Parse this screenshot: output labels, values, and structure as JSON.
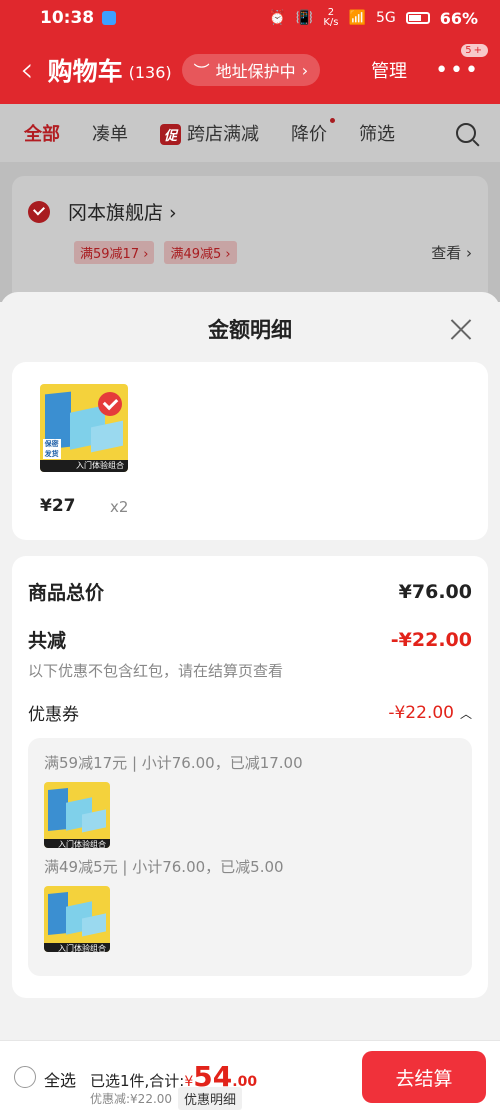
{
  "status_bar": {
    "time": "10:38",
    "net_speed": "2\nK/s",
    "signal": "5G",
    "battery": "66%"
  },
  "header": {
    "title": "购物车",
    "count": "(136)",
    "address_protect": "地址保护中",
    "manage": "管理",
    "more_badge": "5+"
  },
  "tabs": [
    {
      "label": "全部"
    },
    {
      "label": "凑单"
    },
    {
      "label": "跨店满减",
      "badge": "促"
    },
    {
      "label": "降价"
    },
    {
      "label": "筛选"
    }
  ],
  "store": {
    "name": "冈本旗舰店",
    "promos": [
      "满59减17",
      "满49减5"
    ],
    "view": "查看"
  },
  "sheet": {
    "title": "金额明细",
    "product": {
      "price": "¥27",
      "qty": "x2",
      "thumb_band": "入门体验组合",
      "thumb_tag_left": "保密\n发货",
      "thumb_top": "SKIN润滑20片"
    },
    "total_label": "商品总价",
    "total_value": "¥76.00",
    "discount_label": "共减",
    "discount_value": "-¥22.00",
    "note": "以下优惠不包含红包，请在结算页查看",
    "coupon_label": "优惠券",
    "coupon_value": "-¥22.00",
    "coupon_lines": [
      "满59减17元 | 小计76.00，已减17.00",
      "满49减5元 | 小计76.00，已减5.00"
    ]
  },
  "bottom": {
    "select_all": "全选",
    "selected_text": "已选1件,合计:",
    "yen": "¥",
    "amount_int": "54",
    "amount_dec": ".00",
    "saved": "优惠减:¥22.00",
    "detail": "优惠明细",
    "checkout": "去结算"
  }
}
